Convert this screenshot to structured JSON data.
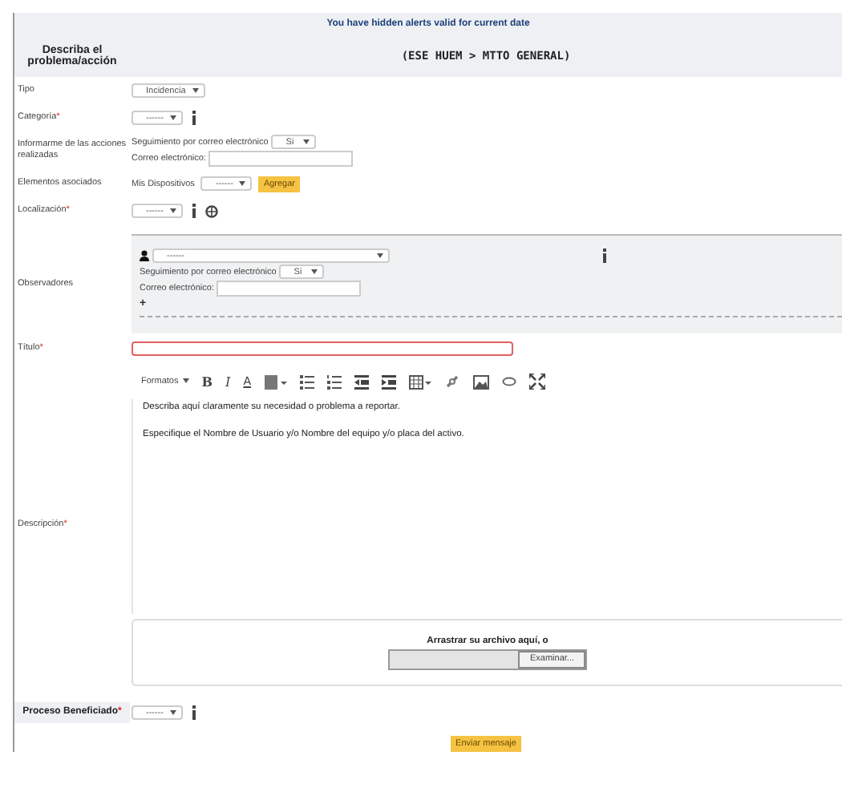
{
  "alert": "You have hidden alerts valid for current date",
  "header": {
    "label": "Describa el problema/acción",
    "path": "(ESE HUEM > MTTO GENERAL)"
  },
  "fields": [
    {
      "kind": "select",
      "label": "Tipo",
      "value": "Incidencia",
      "info": false,
      "globe": false
    },
    {
      "kind": "select",
      "label": "Categoría",
      "mark": "*",
      "value": "------",
      "info": true,
      "globe": false
    },
    {
      "kind": "notify",
      "label": "Informarme de las acciones realizadas",
      "follow_label": "Seguimiento por correo electrónico",
      "follow_value": "Si",
      "email_label": "Correo electrónico:"
    },
    {
      "kind": "devices",
      "label": "Elementos asociados",
      "devices_label": "Mis Dispositivos",
      "value": "------",
      "button": "Agregar"
    },
    {
      "kind": "select",
      "label": "Localización",
      "mark": "*",
      "value": "------",
      "info": true,
      "globe": true
    }
  ],
  "observers": {
    "label": "Observadores",
    "user_value": "------",
    "follow_label": "Seguimiento por correo electrónico",
    "follow_value": "Si",
    "email_label": "Correo electrónico:",
    "add": "+"
  },
  "title_field": {
    "label": "Título",
    "mark": "*",
    "invalid": true
  },
  "description": {
    "label": "Descripción",
    "mark": "*",
    "menu": "Formatos",
    "glyphs": [
      "B",
      "I",
      "A"
    ],
    "lines": [
      "Describa aquí claramente su necesidad o problema a reportar.",
      "Especifique el Nombre de Usuario y/o Nombre del equipo y/o placa del activo."
    ],
    "drop_text": "Arrastrar su archivo aquí, o",
    "browse": "Examinar..."
  },
  "process": {
    "label": "Proceso Beneficiado",
    "mark": "*",
    "value": "------"
  },
  "submit": "Enviar mensaje"
}
